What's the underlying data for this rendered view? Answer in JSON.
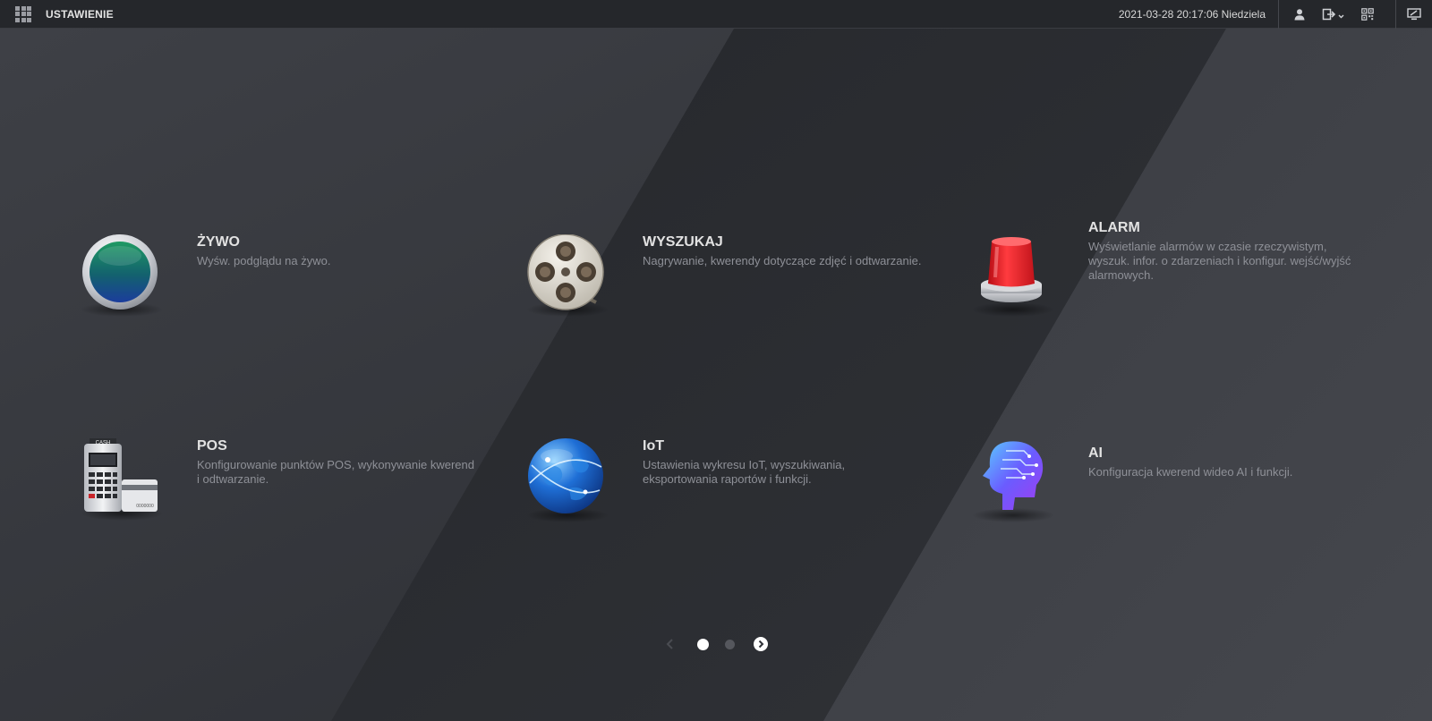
{
  "header": {
    "title": "USTAWIENIE",
    "datetime": "2021-03-28 20:17:06 Niedziela",
    "icons": [
      "menu-grid-icon",
      "user-icon",
      "logout-icon",
      "qr-code-icon",
      "monitor-icon"
    ]
  },
  "tiles": [
    {
      "title": "ŻYWO",
      "desc": [
        "Wyśw. podglądu na żywo."
      ],
      "icon": "live-lens-icon"
    },
    {
      "title": "WYSZUKAJ",
      "desc": [
        "Nagrywanie, kwerendy dotyczące zdjęć i odtwarzanie."
      ],
      "icon": "film-reel-icon"
    },
    {
      "title": "ALARM",
      "desc": [
        "Wyświetlanie alarmów w czasie rzeczywistym,",
        "wyszuk. infor. o zdarzeniach i konfigur. wejść/wyjść",
        "alarmowych."
      ],
      "icon": "alarm-siren-icon"
    },
    {
      "title": "POS",
      "desc": [
        "Konfigurowanie punktów POS, wykonywanie kwerend",
        "i odtwarzanie."
      ],
      "icon": "cash-register-icon"
    },
    {
      "title": "IoT",
      "desc": [
        "Ustawienia wykresu IoT, wyszukiwania,",
        "eksportowania raportów i funkcji."
      ],
      "icon": "globe-icon"
    },
    {
      "title": "AI",
      "desc": [
        "Konfiguracja kwerend wideo AI i funkcji."
      ],
      "icon": "ai-head-icon"
    }
  ],
  "pos_icon_text": {
    "top": "CASH",
    "card": "0000000"
  },
  "pagination": {
    "pages": 2,
    "current": 1
  },
  "colors": {
    "background": "#2e3036",
    "topbar": "#25272b",
    "alarm_red": "#e8232a",
    "live_green": "#1a8a5c",
    "globe_blue": "#1f6fd6"
  }
}
